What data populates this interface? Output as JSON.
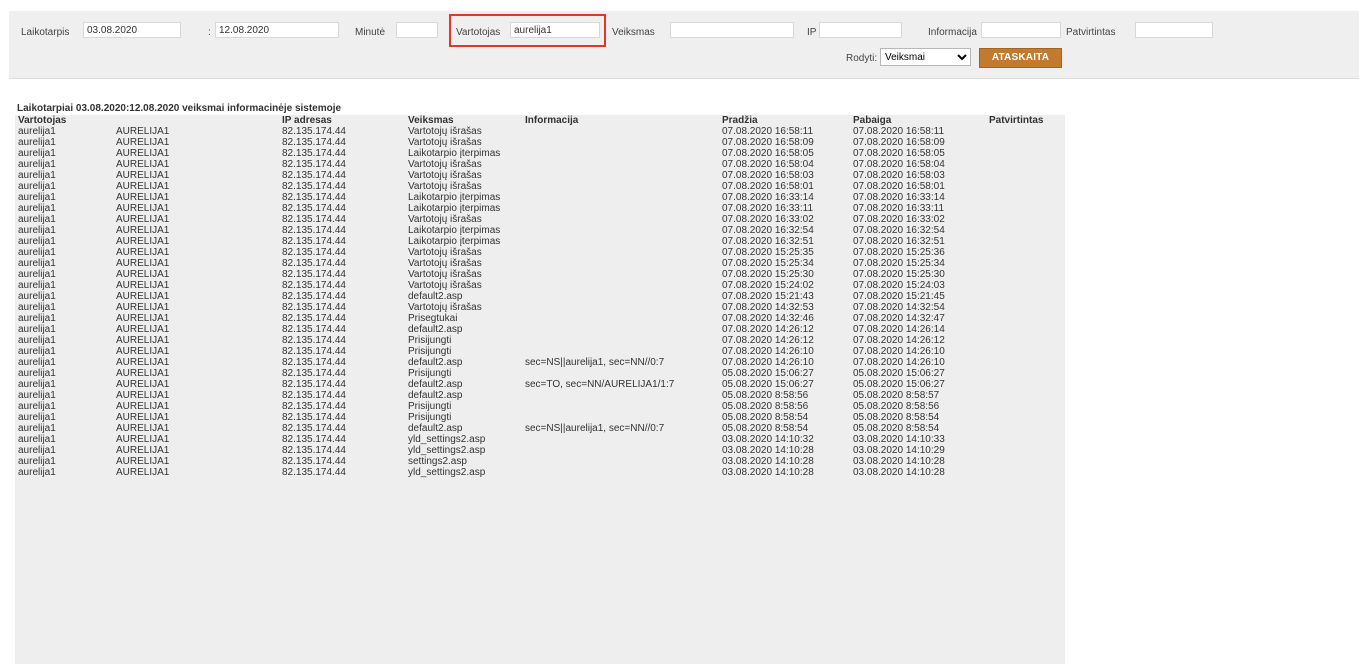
{
  "filters": {
    "period_label": "Laikotarpis",
    "period_from": "03.08.2020",
    "period_sep": ":",
    "period_to": "12.08.2020",
    "minute_label": "Minutė",
    "minute_value": "",
    "user_label": "Vartotojas",
    "user_value": "aurelija1",
    "action_label": "Veiksmas",
    "action_value": "",
    "ip_label": "IP",
    "ip_value": "",
    "info_label": "Informacija",
    "info_value": "",
    "confirmed_label": "Patvirtintas",
    "confirmed_value": "",
    "show_label": "Rodyti:",
    "show_value": "Veiksmai",
    "report_button": "ATASKAITA",
    "highlight_color": "#e3342f",
    "button_color": "#c17a2e"
  },
  "report": {
    "title": "Laikotarpiai 03.08.2020:12.08.2020 veiksmai informacinėje sistemoje",
    "columns": [
      "Vartotojas",
      "",
      "IP adresas",
      "Veiksmas",
      "Informacija",
      "Pradžia",
      "Pabaiga",
      "Patvirtintas"
    ],
    "rows": [
      [
        "aurelija1",
        "AURELIJA1",
        "82.135.174.44",
        "Vartotojų išrašas",
        "",
        "07.08.2020 16:58:11",
        "07.08.2020 16:58:11",
        ""
      ],
      [
        "aurelija1",
        "AURELIJA1",
        "82.135.174.44",
        "Vartotojų išrašas",
        "",
        "07.08.2020 16:58:09",
        "07.08.2020 16:58:09",
        ""
      ],
      [
        "aurelija1",
        "AURELIJA1",
        "82.135.174.44",
        "Laikotarpio įterpimas",
        "",
        "07.08.2020 16:58:05",
        "07.08.2020 16:58:05",
        ""
      ],
      [
        "aurelija1",
        "AURELIJA1",
        "82.135.174.44",
        "Vartotojų išrašas",
        "",
        "07.08.2020 16:58:04",
        "07.08.2020 16:58:04",
        ""
      ],
      [
        "aurelija1",
        "AURELIJA1",
        "82.135.174.44",
        "Vartotojų išrašas",
        "",
        "07.08.2020 16:58:03",
        "07.08.2020 16:58:03",
        ""
      ],
      [
        "aurelija1",
        "AURELIJA1",
        "82.135.174.44",
        "Vartotojų išrašas",
        "",
        "07.08.2020 16:58:01",
        "07.08.2020 16:58:01",
        ""
      ],
      [
        "aurelija1",
        "AURELIJA1",
        "82.135.174.44",
        "Laikotarpio įterpimas",
        "",
        "07.08.2020 16:33:14",
        "07.08.2020 16:33:14",
        ""
      ],
      [
        "aurelija1",
        "AURELIJA1",
        "82.135.174.44",
        "Laikotarpio įterpimas",
        "",
        "07.08.2020 16:33:11",
        "07.08.2020 16:33:11",
        ""
      ],
      [
        "aurelija1",
        "AURELIJA1",
        "82.135.174.44",
        "Vartotojų išrašas",
        "",
        "07.08.2020 16:33:02",
        "07.08.2020 16:33:02",
        ""
      ],
      [
        "aurelija1",
        "AURELIJA1",
        "82.135.174.44",
        "Laikotarpio įterpimas",
        "",
        "07.08.2020 16:32:54",
        "07.08.2020 16:32:54",
        ""
      ],
      [
        "aurelija1",
        "AURELIJA1",
        "82.135.174.44",
        "Laikotarpio įterpimas",
        "",
        "07.08.2020 16:32:51",
        "07.08.2020 16:32:51",
        ""
      ],
      [
        "aurelija1",
        "AURELIJA1",
        "82.135.174.44",
        "Vartotojų išrašas",
        "",
        "07.08.2020 15:25:35",
        "07.08.2020 15:25:36",
        ""
      ],
      [
        "aurelija1",
        "AURELIJA1",
        "82.135.174.44",
        "Vartotojų išrašas",
        "",
        "07.08.2020 15:25:34",
        "07.08.2020 15:25:34",
        ""
      ],
      [
        "aurelija1",
        "AURELIJA1",
        "82.135.174.44",
        "Vartotojų išrašas",
        "",
        "07.08.2020 15:25:30",
        "07.08.2020 15:25:30",
        ""
      ],
      [
        "aurelija1",
        "AURELIJA1",
        "82.135.174.44",
        "Vartotojų išrašas",
        "",
        "07.08.2020 15:24:02",
        "07.08.2020 15:24:03",
        ""
      ],
      [
        "aurelija1",
        "AURELIJA1",
        "82.135.174.44",
        "default2.asp",
        "",
        "07.08.2020 15:21:43",
        "07.08.2020 15:21:45",
        ""
      ],
      [
        "aurelija1",
        "AURELIJA1",
        "82.135.174.44",
        "Vartotojų išrašas",
        "",
        "07.08.2020 14:32:53",
        "07.08.2020 14:32:54",
        ""
      ],
      [
        "aurelija1",
        "AURELIJA1",
        "82.135.174.44",
        "Prisegtukai",
        "",
        "07.08.2020 14:32:46",
        "07.08.2020 14:32:47",
        ""
      ],
      [
        "aurelija1",
        "AURELIJA1",
        "82.135.174.44",
        "default2.asp",
        "",
        "07.08.2020 14:26:12",
        "07.08.2020 14:26:14",
        ""
      ],
      [
        "aurelija1",
        "AURELIJA1",
        "82.135.174.44",
        "Prisijungti",
        "",
        "07.08.2020 14:26:12",
        "07.08.2020 14:26:12",
        ""
      ],
      [
        "aurelija1",
        "AURELIJA1",
        "82.135.174.44",
        "Prisijungti",
        "",
        "07.08.2020 14:26:10",
        "07.08.2020 14:26:10",
        ""
      ],
      [
        "aurelija1",
        "AURELIJA1",
        "82.135.174.44",
        "default2.asp",
        "sec=NS||aurelija1, sec=NN//0:7",
        "07.08.2020 14:26:10",
        "07.08.2020 14:26:10",
        ""
      ],
      [
        "aurelija1",
        "AURELIJA1",
        "82.135.174.44",
        "Prisijungti",
        "",
        "05.08.2020 15:06:27",
        "05.08.2020 15:06:27",
        ""
      ],
      [
        "aurelija1",
        "AURELIJA1",
        "82.135.174.44",
        "default2.asp",
        "sec=TO, sec=NN/AURELIJA1/1:7",
        "05.08.2020 15:06:27",
        "05.08.2020 15:06:27",
        ""
      ],
      [
        "aurelija1",
        "AURELIJA1",
        "82.135.174.44",
        "default2.asp",
        "",
        "05.08.2020 8:58:56",
        "05.08.2020 8:58:57",
        ""
      ],
      [
        "aurelija1",
        "AURELIJA1",
        "82.135.174.44",
        "Prisijungti",
        "",
        "05.08.2020 8:58:56",
        "05.08.2020 8:58:56",
        ""
      ],
      [
        "aurelija1",
        "AURELIJA1",
        "82.135.174.44",
        "Prisijungti",
        "",
        "05.08.2020 8:58:54",
        "05.08.2020 8:58:54",
        ""
      ],
      [
        "aurelija1",
        "AURELIJA1",
        "82.135.174.44",
        "default2.asp",
        "sec=NS||aurelija1, sec=NN//0:7",
        "05.08.2020 8:58:54",
        "05.08.2020 8:58:54",
        ""
      ],
      [
        "aurelija1",
        "AURELIJA1",
        "82.135.174.44",
        "yld_settings2.asp",
        "",
        "03.08.2020 14:10:32",
        "03.08.2020 14:10:33",
        ""
      ],
      [
        "aurelija1",
        "AURELIJA1",
        "82.135.174.44",
        "yld_settings2.asp",
        "",
        "03.08.2020 14:10:28",
        "03.08.2020 14:10:29",
        ""
      ],
      [
        "aurelija1",
        "AURELIJA1",
        "82.135.174.44",
        "settings2.asp",
        "",
        "03.08.2020 14:10:28",
        "03.08.2020 14:10:28",
        ""
      ],
      [
        "aurelija1",
        "AURELIJA1",
        "82.135.174.44",
        "yld_settings2.asp",
        "",
        "03.08.2020 14:10:28",
        "03.08.2020 14:10:28",
        ""
      ]
    ]
  }
}
